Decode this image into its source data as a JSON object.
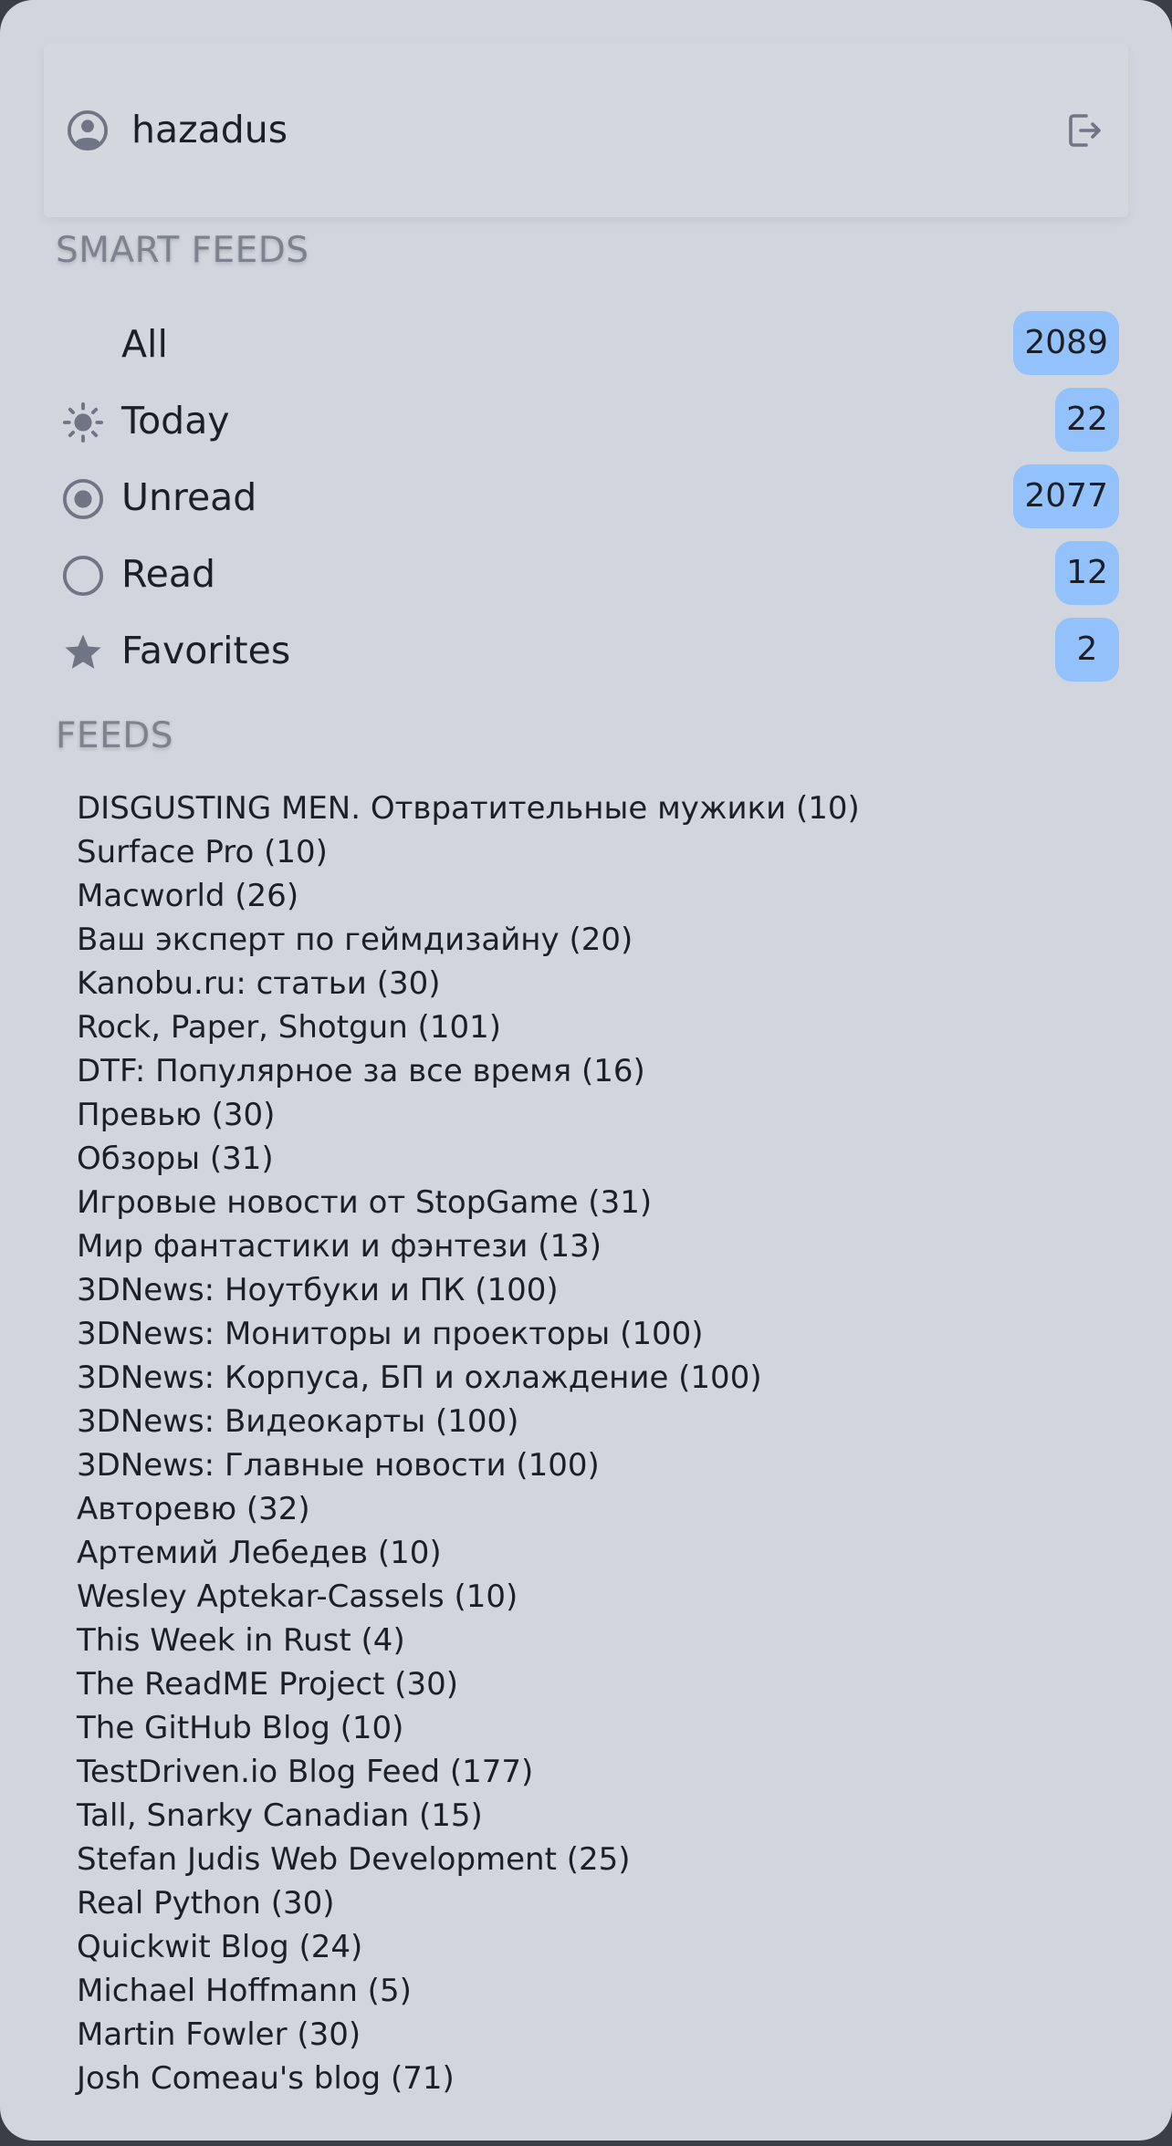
{
  "user": {
    "name": "hazadus"
  },
  "icons": {
    "user": "user-circle-icon",
    "logout": "logout-icon",
    "today": "sun-icon",
    "unread": "radio-filled-icon",
    "read": "radio-empty-icon",
    "favorites": "star-icon"
  },
  "colors": {
    "badge": "#93c1fb",
    "panel": "#d1d5dd",
    "icon": "#6f7582"
  },
  "smart_feeds": {
    "title": "SMART FEEDS",
    "items": [
      {
        "label": "All",
        "count": "2089"
      },
      {
        "label": "Today",
        "count": "22"
      },
      {
        "label": "Unread",
        "count": "2077"
      },
      {
        "label": "Read",
        "count": "12"
      },
      {
        "label": "Favorites",
        "count": "2"
      }
    ]
  },
  "feeds": {
    "title": "FEEDS",
    "items": [
      "DISGUSTING MEN. Отвратительные мужики (10)",
      "Surface Pro (10)",
      "Macworld (26)",
      "Ваш эксперт по геймдизайну (20)",
      "Kanobu.ru: статьи (30)",
      "Rock, Paper, Shotgun (101)",
      "DTF: Популярное за все время (16)",
      "Превью (30)",
      "Обзоры (31)",
      "Игровые новости от StopGame (31)",
      "Мир фантастики и фэнтези (13)",
      "3DNews: Ноутбуки и ПК (100)",
      "3DNews: Мониторы и проекторы (100)",
      "3DNews: Корпуса, БП и охлаждение (100)",
      "3DNews: Видеокарты (100)",
      "3DNews: Главные новости (100)",
      "Авторевю (32)",
      "Артемий Лебедев (10)",
      "Wesley Aptekar-Cassels (10)",
      "This Week in Rust (4)",
      "The ReadME Project (30)",
      "The GitHub Blog (10)",
      "TestDriven.io Blog Feed (177)",
      "Tall, Snarky Canadian (15)",
      "Stefan Judis Web Development (25)",
      "Real Python (30)",
      "Quickwit Blog (24)",
      "Michael Hoffmann (5)",
      "Martin Fowler (30)",
      "Josh Comeau's blog (71)"
    ]
  }
}
